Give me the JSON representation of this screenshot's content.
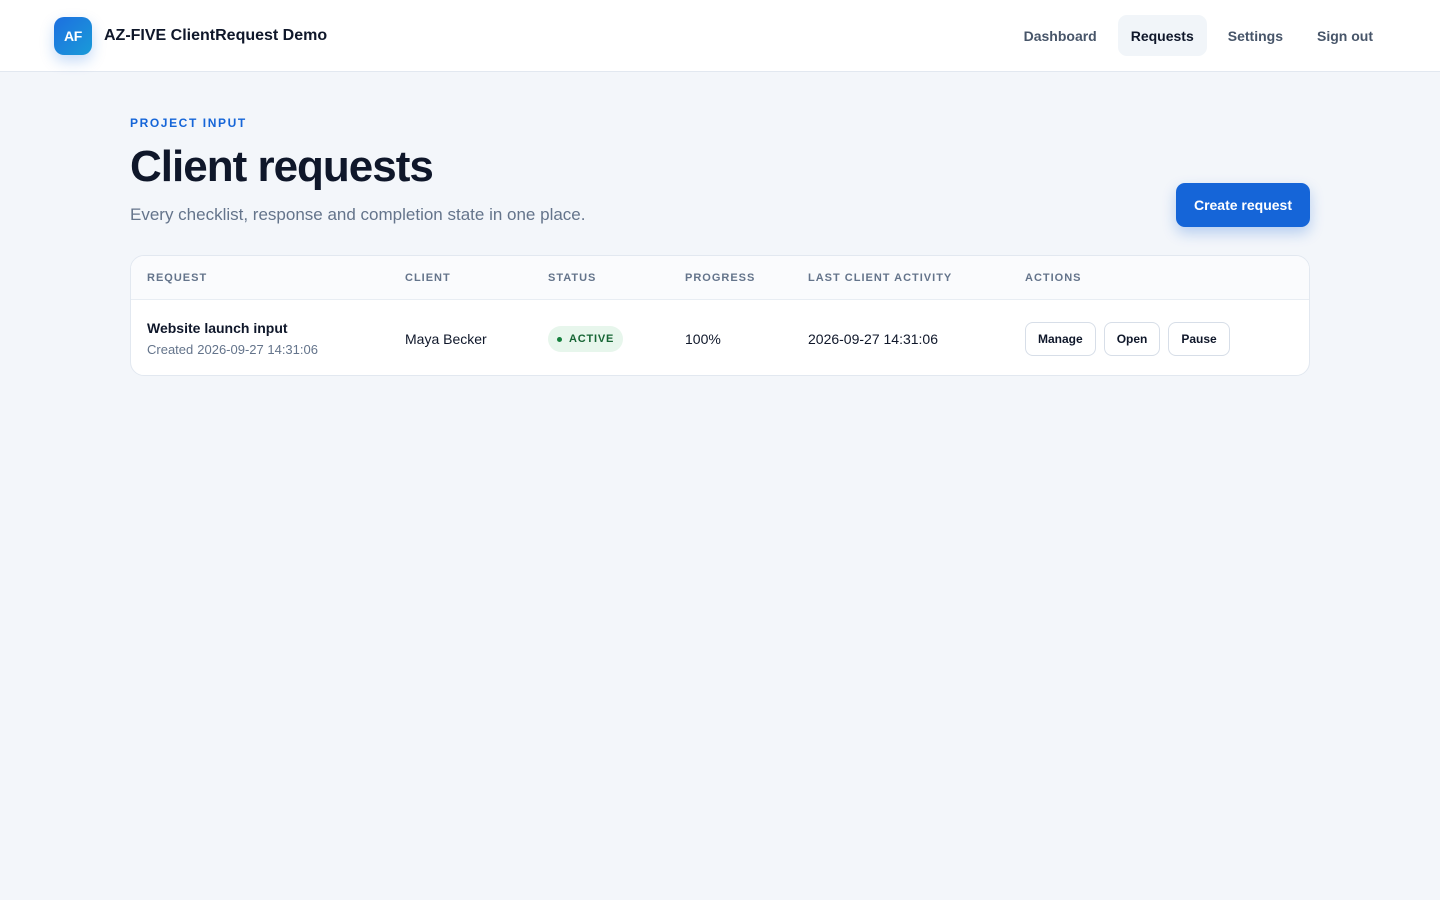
{
  "brand": {
    "logo_text": "AF",
    "name": "AZ-FIVE ClientRequest Demo"
  },
  "nav": {
    "items": [
      {
        "label": "Dashboard",
        "active": false
      },
      {
        "label": "Requests",
        "active": true
      },
      {
        "label": "Settings",
        "active": false
      },
      {
        "label": "Sign out",
        "active": false
      }
    ]
  },
  "header": {
    "eyebrow": "PROJECT INPUT",
    "title": "Client requests",
    "subtitle": "Every checklist, response and completion state in one place.",
    "create_label": "Create request"
  },
  "table": {
    "columns": [
      "REQUEST",
      "CLIENT",
      "STATUS",
      "PROGRESS",
      "LAST CLIENT ACTIVITY",
      "ACTIONS"
    ],
    "rows": [
      {
        "title": "Website launch input",
        "created_label": "Created",
        "created_at": "2026-09-27 14:31:06",
        "client": "Maya Becker",
        "status": "ACTIVE",
        "progress": "100%",
        "last_activity": "2026-09-27 14:31:06",
        "actions": [
          "Manage",
          "Open",
          "Pause"
        ]
      }
    ]
  },
  "colors": {
    "accent": "#1565d8",
    "background": "#f3f6fa",
    "status_active_bg": "#e7f6ec",
    "status_active_text": "#166534"
  }
}
